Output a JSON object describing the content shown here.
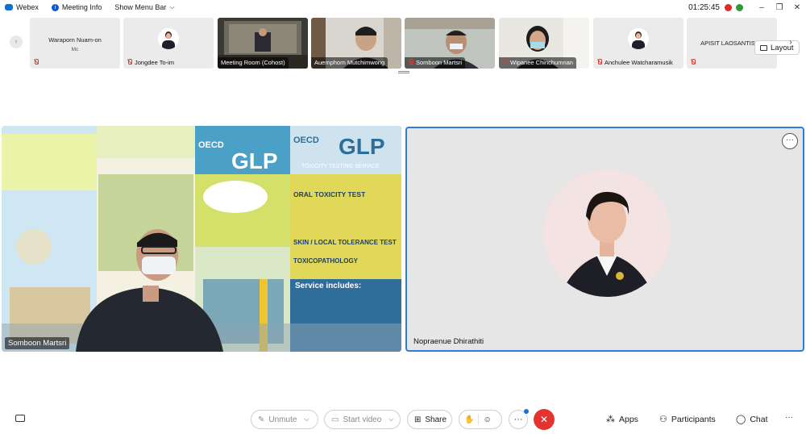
{
  "titlebar": {
    "app_name": "Webex",
    "meeting_info": "Meeting Info",
    "show_menu_bar": "Show Menu Bar",
    "clock": "01:25:45",
    "minimize": "–",
    "restore": "❐",
    "close": "✕"
  },
  "filmstrip": {
    "layout_label": "Layout",
    "tiles": [
      {
        "name": "Waraporn Nuam-on",
        "role": "Mc",
        "muted": false,
        "kind": "name-only"
      },
      {
        "name": "Jongdee To-im",
        "muted": true,
        "kind": "avatar"
      },
      {
        "name": "Meeting Room (Cohost)",
        "muted": false,
        "kind": "camera"
      },
      {
        "name": "Auemphorn Mutchimwong",
        "muted": false,
        "kind": "camera"
      },
      {
        "name": "Somboon Martsri",
        "muted": true,
        "kind": "camera"
      },
      {
        "name": "Wipanee Chinchumnan",
        "muted": true,
        "kind": "camera"
      },
      {
        "name": "Anchulee Watcharamusik",
        "muted": true,
        "kind": "avatar"
      },
      {
        "name": "APISIT LAOSANTISAK",
        "muted": true,
        "kind": "name-only"
      }
    ]
  },
  "stage": {
    "left_name": "Somboon Martsri",
    "right_name": "Nopraenue Dhirathiti",
    "more_label": "···"
  },
  "banner_text": {
    "glp": "GLP",
    "oecd": "OECD",
    "oral": "ORAL TOXICITY TEST",
    "skin": "SKIN / LOCAL TOLERANCE TEST",
    "toxico": "TOXICOPATHOLOGY",
    "service": "Service includes:",
    "testing": "TOXICITY TESTING SERVICE"
  },
  "toolbar": {
    "unmute": "Unmute",
    "start_video": "Start video",
    "share": "Share",
    "apps": "Apps",
    "participants": "Participants",
    "chat": "Chat",
    "more": "···",
    "overflow": "···"
  },
  "colors": {
    "accent": "#2f7dd6",
    "end_call": "#e3342f",
    "muted_icon": "#d83b3b"
  }
}
